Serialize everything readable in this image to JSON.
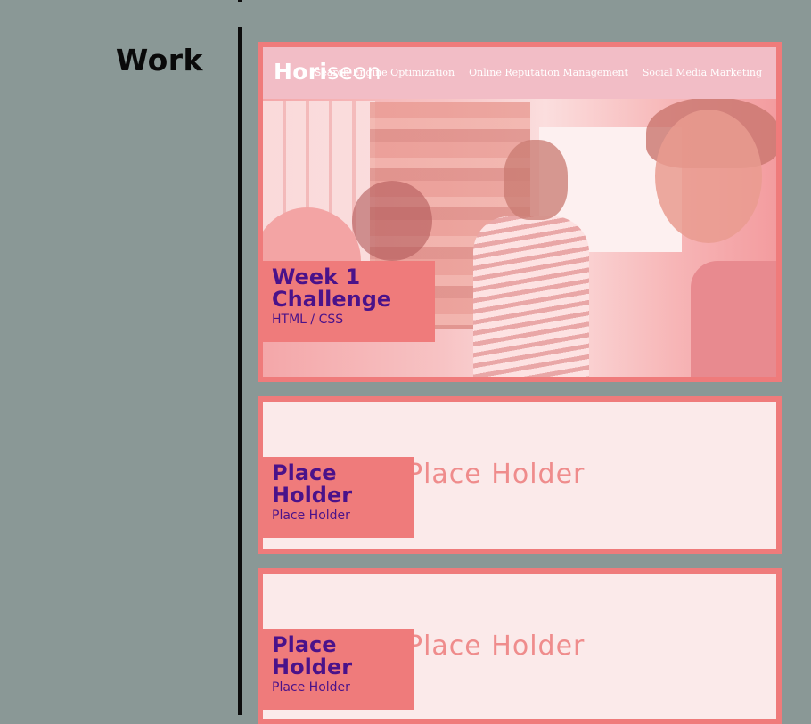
{
  "section": {
    "title": "Work"
  },
  "projects": [
    {
      "site": {
        "brand_main": "Hori",
        "brand_rest": "seon",
        "nav": [
          "Search Engine Optimization",
          "Online Reputation Management",
          "Social Media Marketing"
        ]
      },
      "title": "Week 1 Challenge",
      "subtitle": "HTML / CSS"
    },
    {
      "image_text": "Place Holder",
      "title": "Place Holder",
      "subtitle": "Place Holder"
    },
    {
      "image_text": "Place Holder",
      "title": "Place Holder",
      "subtitle": "Place Holder"
    }
  ],
  "colors": {
    "background": "#8a9896",
    "accent": "#ef7b7b",
    "title_text": "#4a128a",
    "divider": "#0c0c0c"
  }
}
